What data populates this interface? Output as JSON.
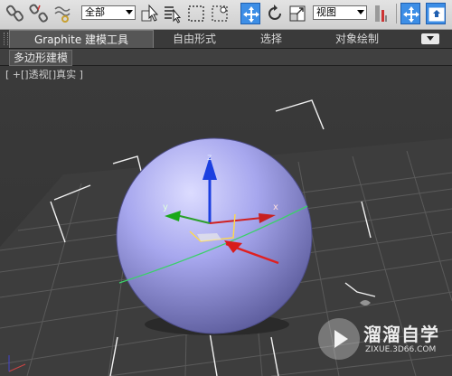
{
  "toolbar": {
    "selection_filter": "全部",
    "reference_coord": "视图",
    "icons": [
      "link-icon",
      "unlink-icon",
      "bind-spacewarp-icon",
      "select-object-icon",
      "select-by-name-icon",
      "rect-selection-region-icon",
      "window-crossing-icon",
      "select-move-icon",
      "select-rotate-icon",
      "select-scale-icon",
      "use-pivot-center-icon",
      "select-manipulate-icon",
      "keyboard-shortcut-icon"
    ]
  },
  "ribbon": {
    "tabs": [
      "Graphite 建模工具",
      "自由形式",
      "选择",
      "对象绘制"
    ]
  },
  "subpanel": {
    "label": "多边形建模"
  },
  "viewport": {
    "label": "[ +[]透视[]真实 ]",
    "sphere_color": "#a7a7ee",
    "axis_labels": {
      "x": "x",
      "y": "y",
      "z": "z"
    }
  },
  "watermark": {
    "title": "溜溜自学",
    "subtitle": "ZIXUE.3D66.COM"
  }
}
